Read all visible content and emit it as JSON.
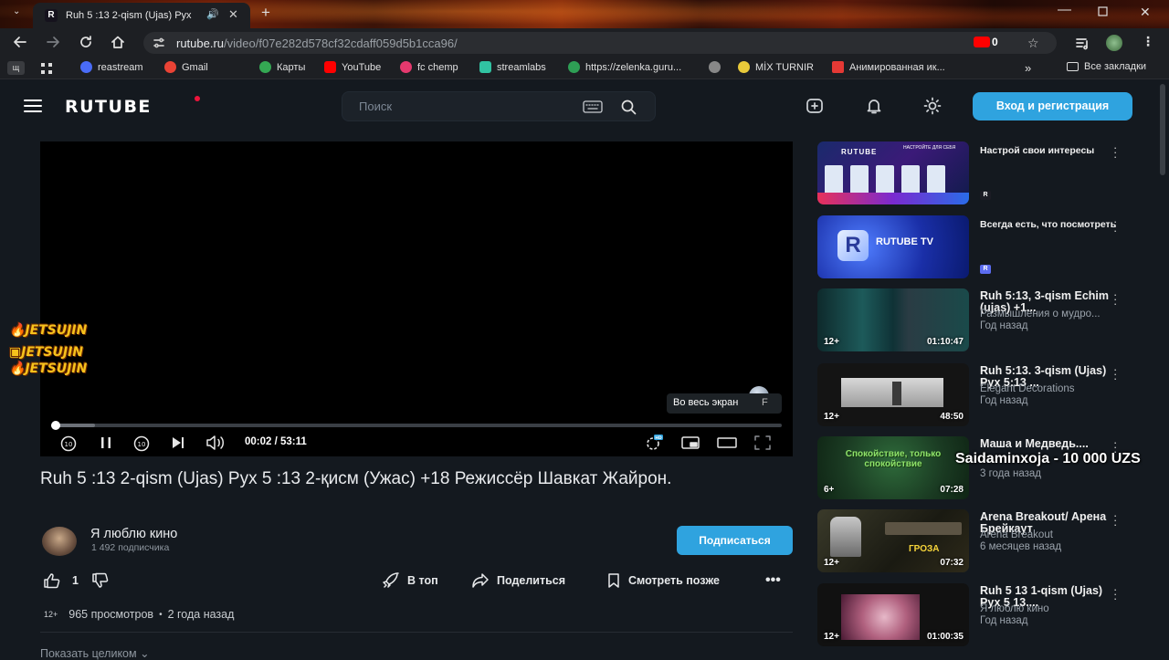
{
  "browser": {
    "tab_title": "Ruh 5 :13 2-qism (Ujas) Рух",
    "tab_favicon": "R",
    "url_host": "rutube.ru",
    "url_path": "/video/f07e282d578cf32cdaff059d5b1cca96/",
    "yt_count": "0",
    "bookmarks": [
      {
        "label": "reastream",
        "color": "#4a6cf7"
      },
      {
        "label": "Gmail",
        "color": "#ea4335"
      },
      {
        "label": "Карты",
        "color": "#34a853"
      },
      {
        "label": "YouTube",
        "color": "#ff0000"
      },
      {
        "label": "fc chemp",
        "color": "#e5396e"
      },
      {
        "label": "streamlabs",
        "color": "#31c3a2"
      },
      {
        "label": "https://zelenka.guru...",
        "color": "#2e9f55"
      },
      {
        "label": "",
        "color": "#888888"
      },
      {
        "label": "MİX TURNIR",
        "color": "#e8c93a"
      },
      {
        "label": "Анимированная ик...",
        "color": "#e53935"
      }
    ],
    "first_bookmark": "щ",
    "all_bookmarks": "Все закладки"
  },
  "header": {
    "logo": "RUTUBE",
    "search_placeholder": "Поиск",
    "login_label": "Вход и регистрация"
  },
  "player": {
    "progress": 0.006,
    "buffered": 0.06,
    "time": "00:02 / 53:11",
    "tooltip_label": "Во весь экран",
    "tooltip_key": "F",
    "overlay_lines": [
      "JETSUJIN",
      "JETSUJIN",
      "JETSUJIN"
    ]
  },
  "video": {
    "title": "Ruh 5 :13 2-qism (Ujas) Рух 5 :13 2-қисм (Ужас) +18 Режиссёр Шавкат Жайрон.",
    "channel": "Я люблю кино",
    "subscribers": "1 492 подписчика",
    "subscribe_label": "Подписаться",
    "likes": "1",
    "actions": {
      "top": "В топ",
      "share": "Поделиться",
      "later": "Смотреть позже"
    },
    "age": "12+",
    "views": "965 просмотров",
    "dot": "•",
    "posted": "2 года назад",
    "show_all": "Показать целиком"
  },
  "sidebar": [
    {
      "title": "Настрой свои интересы",
      "small": true,
      "channel": "",
      "date": "",
      "age": "",
      "duration": ""
    },
    {
      "title": "Всегда есть, что посмотреть",
      "small": true,
      "channel": "",
      "date": "",
      "age": "",
      "duration": ""
    },
    {
      "title": "Ruh 5:13, 3-qism Echim (ujas) +1...",
      "channel": "Размышления о мудро...",
      "date": "Год назад",
      "age": "12+",
      "duration": "01:10:47"
    },
    {
      "title": "Ruh 5:13. 3-qism (Ujas) Рух 5:13 ...",
      "channel": "Elegant Decorations",
      "date": "Год назад",
      "age": "12+",
      "duration": "48:50"
    },
    {
      "title": "Маша и Медведь....",
      "channel": "",
      "date": "3 года назад",
      "age": "6+",
      "duration": "07:28"
    },
    {
      "title": "Arena Breakout/ Арена Брейкаут",
      "channel": "Arena Breakout",
      "date": "6 месяцев назад",
      "age": "12+",
      "duration": "07:32"
    },
    {
      "title": "Ruh 5 13 1-qism (Ujas) Рух 5 13....",
      "channel": "Я люблю кино",
      "date": "Год назад",
      "age": "12+",
      "duration": "01:00:35"
    }
  ],
  "thumb_texts": {
    "rutube_banner": "RUTUBE",
    "rutube_banner_side": "НАСТРОЙТЕ ДЛЯ СЕБЯ",
    "rutube_tv": "RUTUBE TV",
    "masha_text": "Спокойствие, только спокойствие",
    "arena_text": "ГРОЗА"
  },
  "donation_overlay": "Saidaminxoja - 10 000 UZS",
  "colors": {
    "accent": "#2fa3df",
    "background": "#14191f",
    "brand_dot": "#ed143b"
  }
}
